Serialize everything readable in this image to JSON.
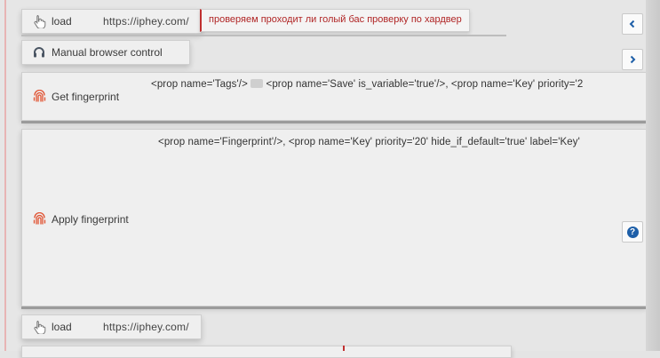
{
  "rows": [
    {
      "type": "action",
      "label": "load",
      "url": "https://iphey.com/",
      "comment": "проверяем проходит ли голый бас проверку по хардвер"
    },
    {
      "type": "action",
      "label": "Manual browser control"
    },
    {
      "type": "action",
      "label": "Get fingerprint",
      "params_before": "<prop name='Tags'/>",
      "params_after": "<prop name='Save' is_variable='true'/>, <prop name='Key' priority='2"
    },
    {
      "type": "action",
      "label": "Apply fingerprint",
      "params": "<prop name='Fingerprint'/>, <prop name='Key' priority='20' hide_if_default='true' label='Key'"
    },
    {
      "type": "action",
      "label": "load",
      "url": "https://iphey.com/"
    }
  ],
  "side_buttons": [
    "collapse-left",
    "expand-right",
    "help"
  ],
  "help_glyph": "?",
  "colors": {
    "comment_text": "#b02525",
    "help_blue": "#1e5fa8",
    "fingerprint_icon": "#e0502f"
  }
}
